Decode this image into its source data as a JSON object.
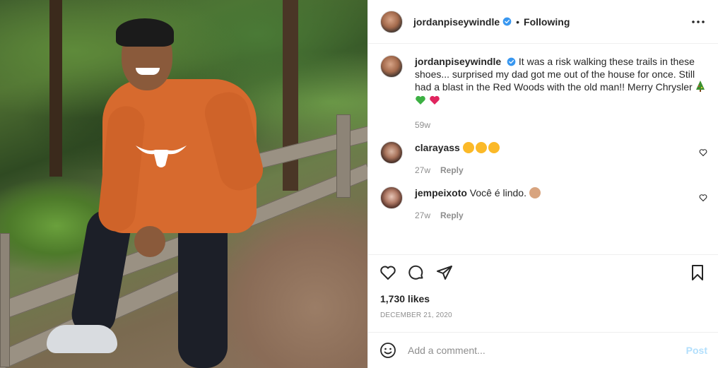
{
  "post": {
    "username": "jordanpiseywindle",
    "separator": "•",
    "follow_state": "Following",
    "caption_username": "jordanpiseywindle",
    "caption_text": "It was a risk walking these trails in these shoes... surprised my dad got me out of the house for once. Still had a blast in the Red Woods with the old man!! Merry Chrysler",
    "caption_age": "59w",
    "likes": "1,730 likes",
    "date": "December 21, 2020",
    "photo_alt": "Young man in an orange Texas Longhorns sweatshirt sitting on a wooden fence in the redwoods"
  },
  "comments": [
    {
      "user": "clarayass",
      "text": "",
      "emojis": [
        "star-struck",
        "star-struck",
        "star-struck"
      ],
      "age": "27w",
      "reply": "Reply"
    },
    {
      "user": "jempeixoto",
      "text": "Você é lindo.",
      "emojis": [
        "clapping-hands"
      ],
      "age": "27w",
      "reply": "Reply"
    }
  ],
  "composer": {
    "placeholder": "Add a comment...",
    "post_label": "Post"
  },
  "colors": {
    "verified": "#3897f0",
    "post_disabled": "#b2dffc",
    "meta": "#8e8e8e"
  }
}
